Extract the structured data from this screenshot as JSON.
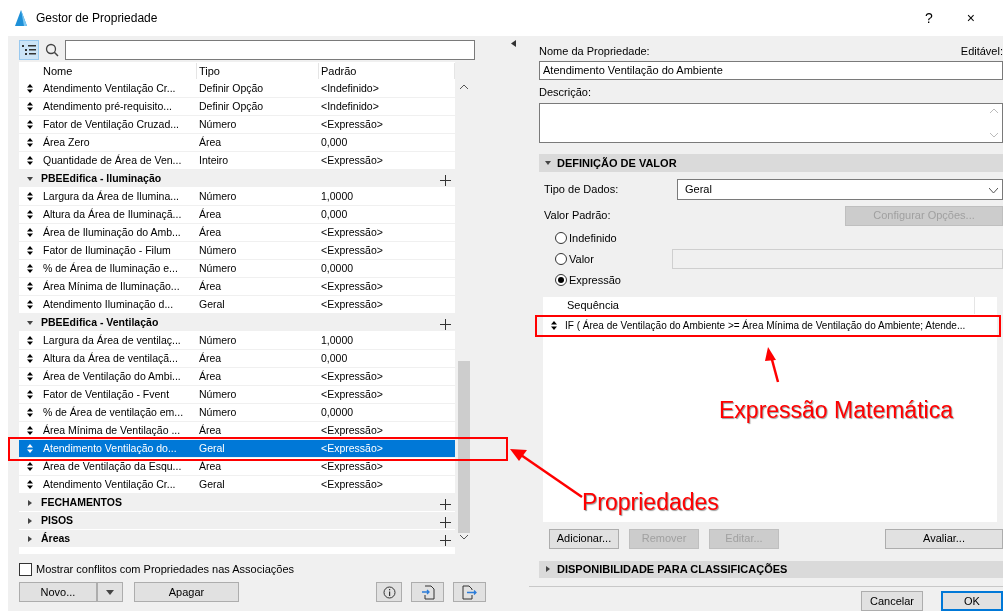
{
  "window": {
    "title": "Gestor de Propriedade",
    "buttons": [
      "?",
      "×"
    ]
  },
  "left": {
    "table": {
      "columns": [
        "Nome",
        "Tipo",
        "Padrão"
      ],
      "items": [
        {
          "kind": "property",
          "name": "Atendimento Ventilação Cr...",
          "type": "Definir Opção",
          "default": "<Indefinido>",
          "selected": false
        },
        {
          "kind": "property",
          "name": "Atendimento  pré-requisito...",
          "type": "Definir Opção",
          "default": "<Indefinido>",
          "selected": false
        },
        {
          "kind": "property",
          "name": "Fator de Ventilação Cruzad...",
          "type": "Número",
          "default": "<Expressão>",
          "selected": false
        },
        {
          "kind": "property",
          "name": "Área Zero",
          "type": "Área",
          "default": "0,000",
          "selected": false
        },
        {
          "kind": "property",
          "name": "Quantidade de Área de Ven...",
          "type": "Inteiro",
          "default": "<Expressão>",
          "selected": false
        },
        {
          "kind": "group",
          "name": "PBEEdifica - Iluminação",
          "expanded": true,
          "children": [
            {
              "kind": "property",
              "name": "Largura da Área de Ilumina...",
              "type": "Número",
              "default": "1,0000",
              "selected": false
            },
            {
              "kind": "property",
              "name": "Altura da Área de Iluminaçã...",
              "type": "Área",
              "default": "0,000",
              "selected": false
            },
            {
              "kind": "property",
              "name": "Área de Iluminação do Amb...",
              "type": "Área",
              "default": "<Expressão>",
              "selected": false
            },
            {
              "kind": "property",
              "name": "Fator de Iluminação - Filum",
              "type": "Número",
              "default": "<Expressão>",
              "selected": false
            },
            {
              "kind": "property",
              "name": "% de Área de Iluminação e...",
              "type": "Número",
              "default": "0,0000",
              "selected": false
            },
            {
              "kind": "property",
              "name": "Área Mínima de Iluminação...",
              "type": "Área",
              "default": "<Expressão>",
              "selected": false
            },
            {
              "kind": "property",
              "name": "Atendimento Iluminação d...",
              "type": "Geral",
              "default": "<Expressão>",
              "selected": false
            }
          ]
        },
        {
          "kind": "group",
          "name": "PBEEdifica - Ventilação",
          "expanded": true,
          "children": [
            {
              "kind": "property",
              "name": "Largura da Área de ventilaç...",
              "type": "Número",
              "default": "1,0000",
              "selected": false
            },
            {
              "kind": "property",
              "name": "Altura da Área de ventilaçã...",
              "type": "Área",
              "default": "0,000",
              "selected": false
            },
            {
              "kind": "property",
              "name": "Área de Ventilação do Ambi...",
              "type": "Área",
              "default": "<Expressão>",
              "selected": false
            },
            {
              "kind": "property",
              "name": "Fator de Ventilação - Fvent",
              "type": "Número",
              "default": "<Expressão>",
              "selected": false
            },
            {
              "kind": "property",
              "name": "% de Área de ventilação em...",
              "type": "Número",
              "default": "0,0000",
              "selected": false
            },
            {
              "kind": "property",
              "name": "Área Mínima de Ventilação ...",
              "type": "Área",
              "default": "<Expressão>",
              "selected": false
            },
            {
              "kind": "property",
              "name": "Atendimento Ventilação do...",
              "type": "Geral",
              "default": "<Expressão>",
              "selected": true
            },
            {
              "kind": "property",
              "name": "Área de Ventilação da Esqu...",
              "type": "Área",
              "default": "<Expressão>",
              "selected": false
            },
            {
              "kind": "property",
              "name": "Atendimento Ventilação  Cr...",
              "type": "Geral",
              "default": "<Expressão>",
              "selected": false
            }
          ]
        },
        {
          "kind": "group",
          "name": "FECHAMENTOS",
          "expanded": false
        },
        {
          "kind": "group",
          "name": "PISOS",
          "expanded": false
        },
        {
          "kind": "group",
          "name": "Áreas",
          "expanded": false
        }
      ]
    },
    "conflicts_checkbox": {
      "label": "Mostrar conflitos com Propriedades nas Associações",
      "checked": false
    },
    "buttons": [
      {
        "label": "Novo..."
      },
      {
        "label": "Apagar"
      }
    ]
  },
  "right": {
    "name_label": "Nome da Propriedade:",
    "editable_label": "Editável:",
    "name_value": "Atendimento Ventilação do Ambiente",
    "description_label": "Descrição:",
    "value_section": {
      "title": "DEFINIÇÃO DE VALOR",
      "expanded": true
    },
    "data_type_label": "Tipo de Dados:",
    "data_type": "Geral",
    "default_label": "Valor Padrão:",
    "configure_button": {
      "label": "Configurar Opções...",
      "disabled": true
    },
    "radios": [
      {
        "label": "Indefinido",
        "selected": false
      },
      {
        "label": "Valor",
        "selected": false
      },
      {
        "label": "Expressão",
        "selected": true
      }
    ],
    "sequence": {
      "column": "Sequência",
      "rows": [
        "IF ( Área de Ventilação do Ambiente >= Área Mínima de Ventilação do Ambiente; Atende..."
      ]
    },
    "buttons": [
      {
        "label": "Adicionar...",
        "disabled": false
      },
      {
        "label": "Remover",
        "disabled": true
      },
      {
        "label": "Editar...",
        "disabled": true
      },
      {
        "label": "Avaliar...",
        "disabled": false
      }
    ],
    "availability_section": {
      "title": "DISPONIBILIDADE PARA CLASSIFICAÇÕES",
      "expanded": false
    }
  },
  "footer_buttons": [
    {
      "label": "Cancelar",
      "default": false
    },
    {
      "label": "OK",
      "default": true
    }
  ],
  "annotations": [
    {
      "text": "Propriedades"
    },
    {
      "text": "Expressão Matemática"
    }
  ]
}
